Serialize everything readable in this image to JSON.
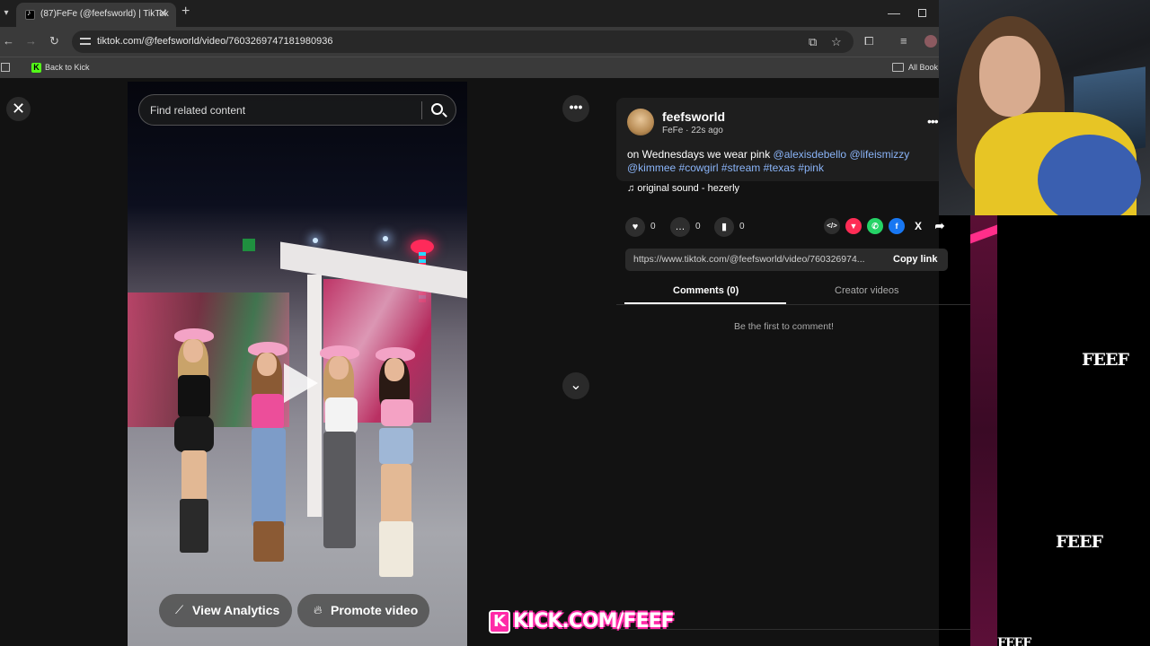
{
  "browser": {
    "tab_title": "(87)FeFe (@feefsworld) | TikTok",
    "url": "tiktok.com/@feefsworld/video/7603269747181980936",
    "bookmarks": {
      "back_to_kick": "Back to Kick",
      "all_bookmarks": "All Book"
    }
  },
  "video": {
    "search_placeholder": "Find related content",
    "view_analytics": "View Analytics",
    "promote_video": "Promote video"
  },
  "post": {
    "username": "feefsworld",
    "subline": "FeFe · 22s ago",
    "caption_text": "on Wednesdays we wear pink",
    "caption_tags": [
      "@alexisdebello",
      "@lifeismizzy",
      "@kimmee",
      "#cowgirl",
      "#stream",
      "#texas",
      "#pink"
    ],
    "sound": "original sound - hezerly",
    "counts": {
      "likes": "0",
      "comments": "0",
      "saves": "0"
    },
    "share_link": "https://www.tiktok.com/@feefsworld/video/760326974...",
    "copy_link": "Copy link"
  },
  "tabs": {
    "comments": "Comments (0)",
    "creator_videos": "Creator videos"
  },
  "comments_empty": "Be the first to comment!",
  "overlay": {
    "kick_url": "KICK.COM/FEEF",
    "feef_logo": "FEEF"
  },
  "colors": {
    "link_blue": "#8ab4f8",
    "kick_pink": "#ff2aa8",
    "whatsapp": "#25d366",
    "facebook": "#1877f2",
    "tiktok_red": "#fe2c55"
  },
  "icons": [
    "back-icon",
    "forward-icon",
    "reload-icon",
    "close-icon",
    "search-icon",
    "more-icon",
    "chevron-down-icon",
    "heart-icon",
    "comment-icon",
    "bookmark-icon",
    "embed-icon",
    "tiktok-share-icon",
    "whatsapp-icon",
    "facebook-icon",
    "x-icon",
    "share-arrow-icon",
    "music-note-icon",
    "chart-icon",
    "flame-icon"
  ]
}
